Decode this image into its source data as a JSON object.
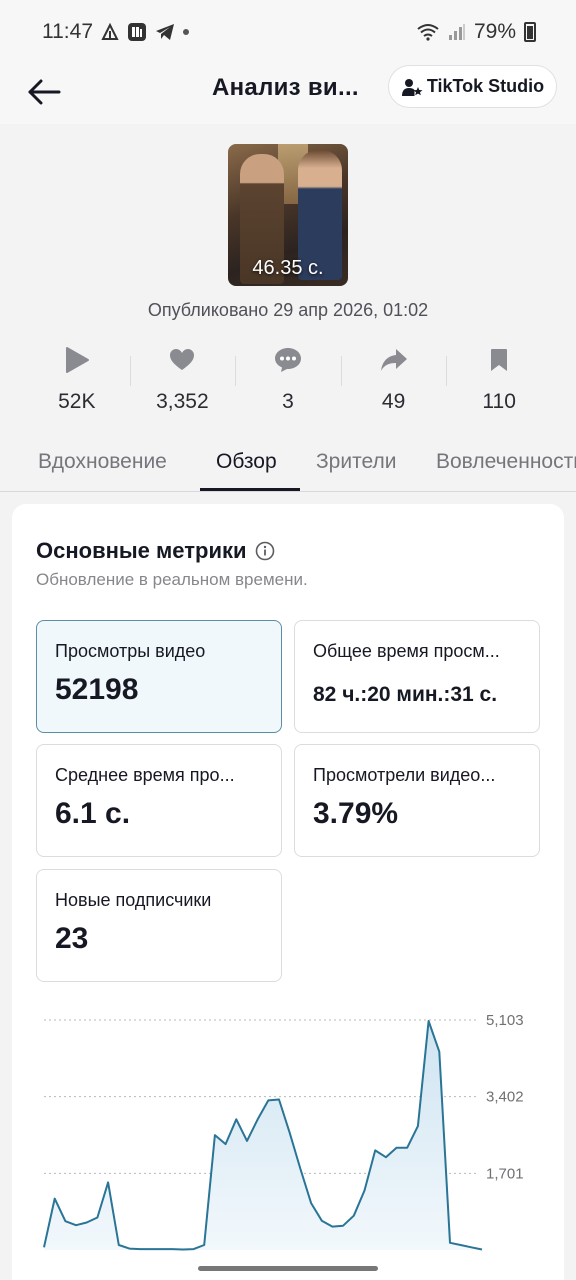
{
  "status_bar": {
    "time": "11:47",
    "battery": "79%"
  },
  "header": {
    "title": "Анализ ви...",
    "studio_label": "TikTok Studio"
  },
  "video": {
    "duration": "46.35 с.",
    "published": "Опубликовано 29 апр 2026, 01:02"
  },
  "stats": {
    "views": "52K",
    "likes": "3,352",
    "comments": "3",
    "shares": "49",
    "saves": "110"
  },
  "tabs": [
    "Вдохновение",
    "Обзор",
    "Зрители",
    "Вовлеченность"
  ],
  "card": {
    "title": "Основные метрики",
    "subtitle": "Обновление в реальном времени.",
    "metrics": [
      {
        "label": "Просмотры видео",
        "value": "52198"
      },
      {
        "label": "Общее время просм...",
        "value": "82 ч.:20 мин.:31 с."
      },
      {
        "label": "Среднее время про...",
        "value": "6.1 с."
      },
      {
        "label": "Просмотрели видео...",
        "value": "3.79%"
      },
      {
        "label": "Новые подписчики",
        "value": "23"
      }
    ]
  },
  "colors": {
    "accent": "#2a7496",
    "selected_bg": "#f0f8fc",
    "selected_border": "#5a8fa3"
  },
  "chart_data": {
    "type": "area",
    "ticks": [
      "5,103",
      "3,402",
      "1,701"
    ],
    "ylim": [
      0,
      5103
    ],
    "values": [
      60,
      1140,
      640,
      550,
      610,
      720,
      1500,
      110,
      30,
      20,
      20,
      20,
      20,
      10,
      20,
      110,
      2550,
      2350,
      2900,
      2420,
      2900,
      3320,
      3340,
      2600,
      1800,
      1040,
      650,
      520,
      540,
      760,
      1320,
      2210,
      2060,
      2270,
      2270,
      2750,
      5080,
      4400,
      160,
      110,
      60,
      10
    ],
    "grid": true,
    "legend": "none"
  }
}
